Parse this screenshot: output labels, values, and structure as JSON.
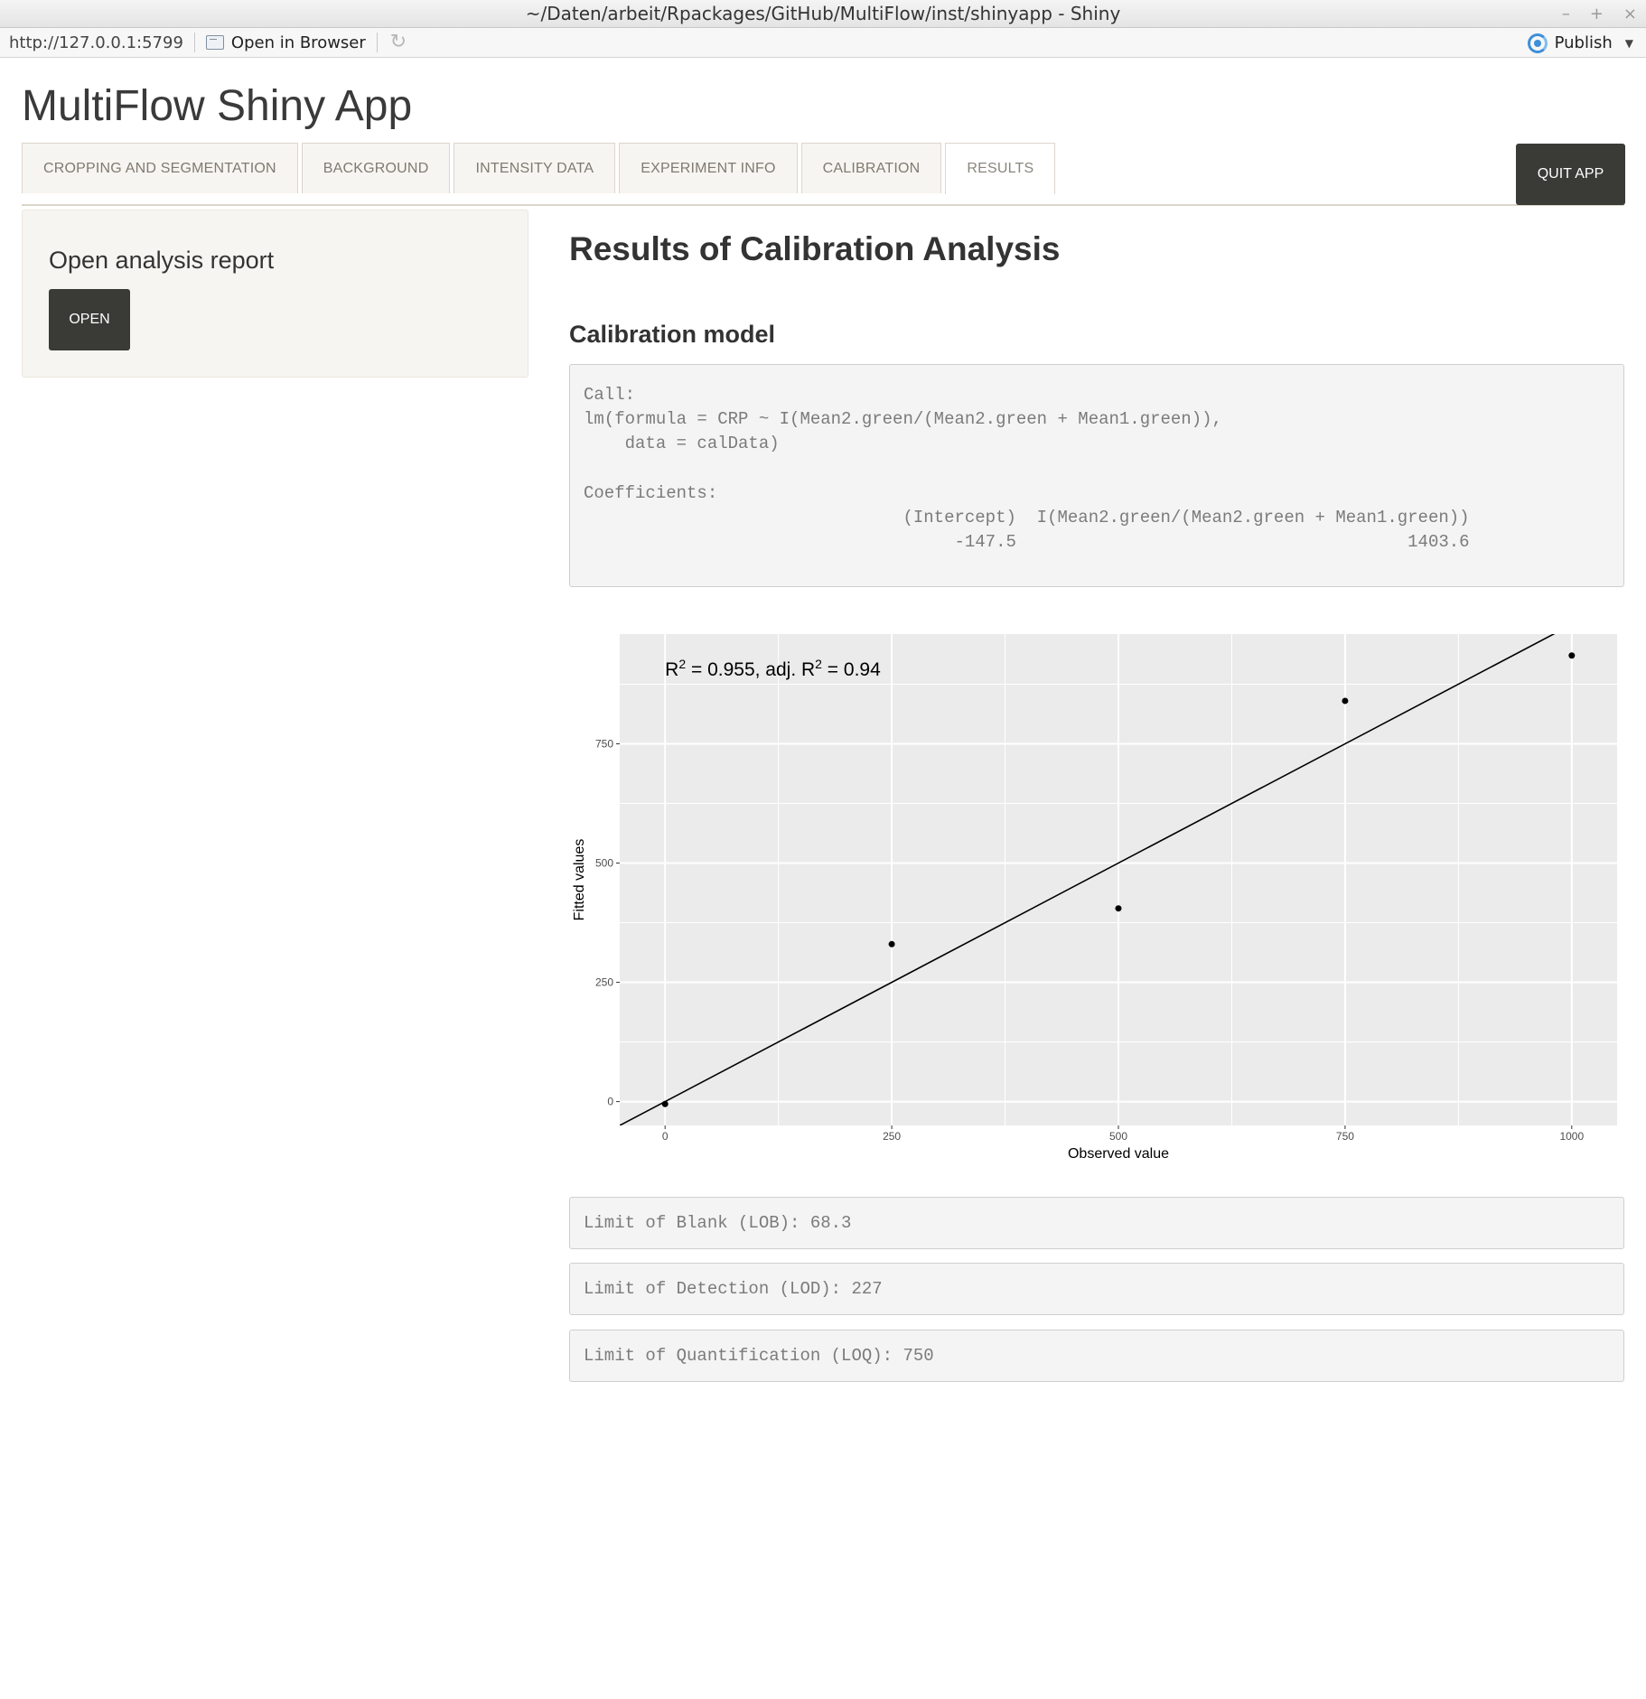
{
  "window": {
    "title": "~/Daten/arbeit/Rpackages/GitHub/MultiFlow/inst/shinyapp - Shiny",
    "controls": [
      "–",
      "+",
      "×"
    ]
  },
  "toolbar": {
    "url": "http://127.0.0.1:5799",
    "open_in_browser": "Open in Browser",
    "publish": "Publish"
  },
  "app": {
    "title": "MultiFlow Shiny App",
    "tabs": [
      {
        "label": "CROPPING AND SEGMENTATION"
      },
      {
        "label": "BACKGROUND"
      },
      {
        "label": "INTENSITY DATA"
      },
      {
        "label": "EXPERIMENT INFO"
      },
      {
        "label": "CALIBRATION"
      },
      {
        "label": "RESULTS",
        "active": true
      }
    ],
    "quit_label": "QUIT APP"
  },
  "sidebar": {
    "heading": "Open analysis report",
    "open_label": "OPEN"
  },
  "main": {
    "title": "Results of Calibration Analysis",
    "model_heading": "Calibration model",
    "model_output": "Call:\nlm(formula = CRP ~ I(Mean2.green/(Mean2.green + Mean1.green)),\n    data = calData)\n\nCoefficients:\n                               (Intercept)  I(Mean2.green/(Mean2.green + Mean1.green))\n                                    -147.5                                      1403.6",
    "lob": "Limit of Blank (LOB): 68.3",
    "lod": "Limit of Detection (LOD): 227",
    "loq": "Limit of Quantification (LOQ): 750"
  },
  "chart_data": {
    "type": "scatter",
    "title": "",
    "annotation": {
      "r2": "0.955",
      "adj_r2": "0.94"
    },
    "xlabel": "Observed value",
    "ylabel": "Fitted values",
    "xlim": [
      -50,
      1050
    ],
    "ylim": [
      -50,
      980
    ],
    "xticks": [
      0,
      250,
      500,
      750,
      1000
    ],
    "yticks": [
      0,
      250,
      500,
      750
    ],
    "grid": true,
    "points": [
      {
        "x": 0,
        "y": -5
      },
      {
        "x": 250,
        "y": 330
      },
      {
        "x": 500,
        "y": 405
      },
      {
        "x": 750,
        "y": 840
      },
      {
        "x": 1000,
        "y": 935
      }
    ],
    "reference_line": {
      "intercept": 0,
      "slope": 1
    },
    "colors": {
      "panel": "#ebebeb",
      "grid": "#ffffff",
      "point": "#000000",
      "line": "#000000"
    }
  }
}
